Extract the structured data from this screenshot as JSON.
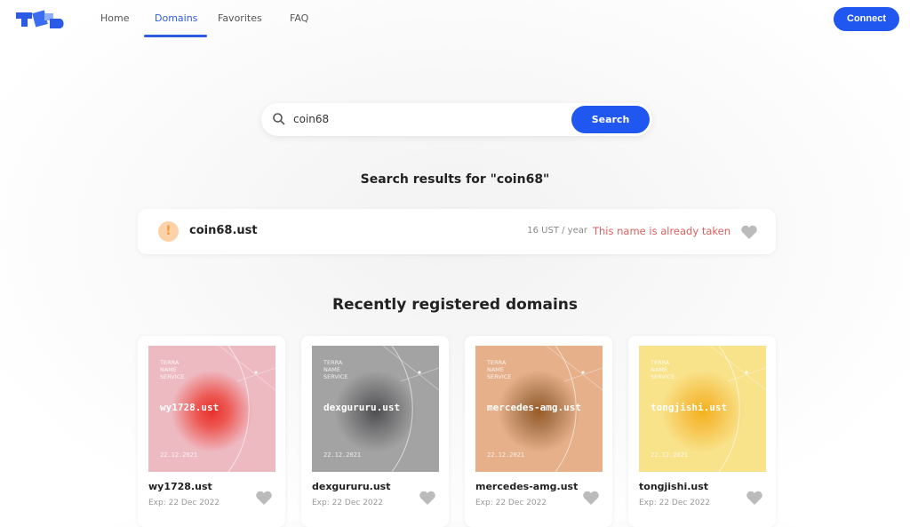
{
  "nav": {
    "items": [
      "Home",
      "Domains",
      "Favorites",
      "FAQ"
    ],
    "active": "Domains",
    "connect": "Connect"
  },
  "search": {
    "value": "coin68",
    "button": "Search"
  },
  "results_title": "Search results for \"coin68\"",
  "result": {
    "name": "coin68.ust",
    "price": "16 UST / year",
    "status": "This name is already taken"
  },
  "recent_title": "Recently registered domains",
  "cards": [
    {
      "name": "wy1728.ust",
      "art_name": "wy1728.ust",
      "brand": "TERRA NAME SERVICE",
      "date": "22.12.2021",
      "exp": "Exp: 22 Dec 2022",
      "bg": "#eebac2",
      "blob": "#e8302a"
    },
    {
      "name": "dexgururu.ust",
      "art_name": "dexgururu.ust",
      "brand": "TERRA NAME SERVICE",
      "date": "22.12.2021",
      "exp": "Exp: 22 Dec 2022",
      "bg": "#a3a3a4",
      "blob": "#4e4e50"
    },
    {
      "name": "mercedes-amg.ust",
      "art_name": "mercedes-amg.ust",
      "brand": "TERRA NAME SERVICE",
      "date": "22.12.2021",
      "exp": "Exp: 22 Dec 2022",
      "bg": "#e6b08a",
      "blob": "#9a5a26"
    },
    {
      "name": "tongjishi.ust",
      "art_name": "tongjishi.ust",
      "brand": "TERRA NAME SERVICE",
      "date": "22.12.2021",
      "exp": "Exp: 22 Dec 2022",
      "bg": "#f8e28a",
      "blob": "#f4b21c"
    }
  ],
  "colors": {
    "accent": "#1f57f0",
    "taken": "#d9605f"
  }
}
